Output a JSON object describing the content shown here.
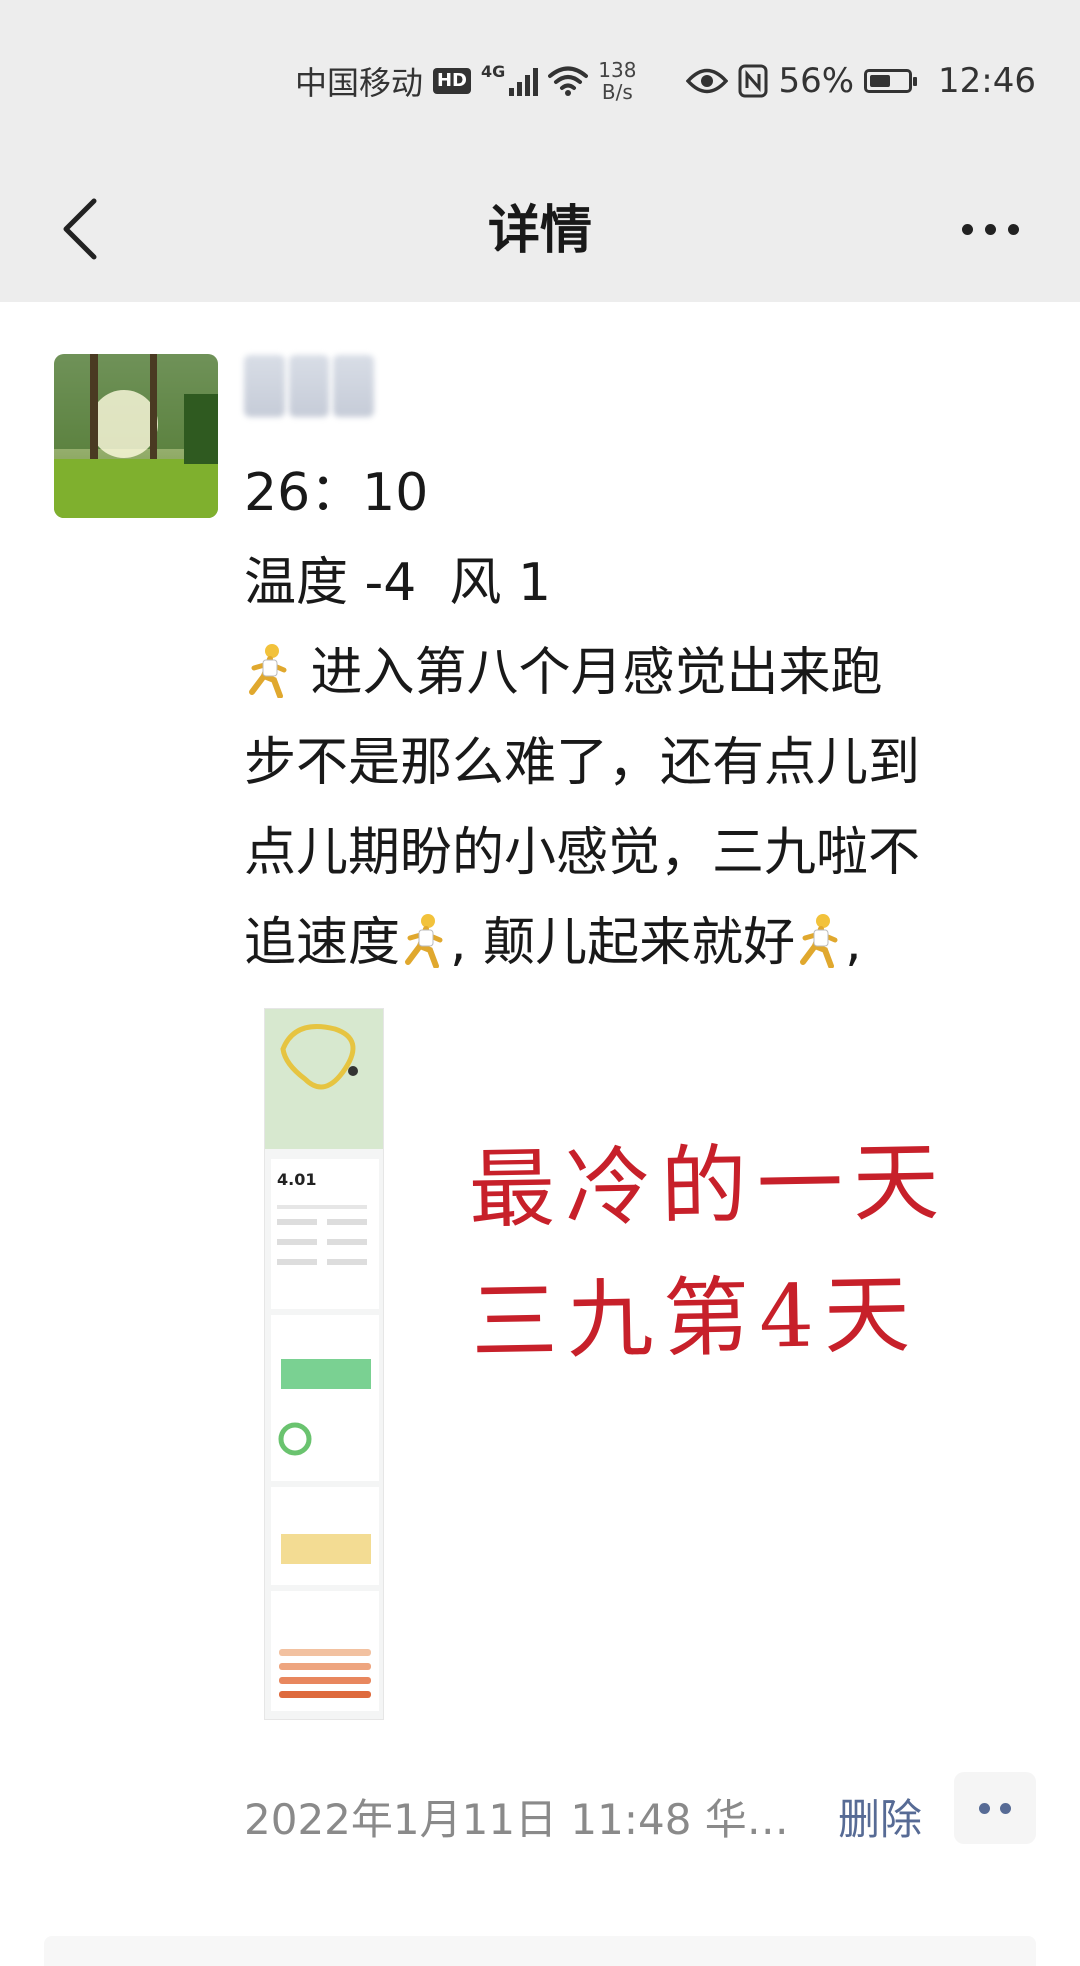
{
  "status_bar": {
    "carrier": "中国移动",
    "hd": "HD",
    "network": "4G",
    "speed_value": "138",
    "speed_unit": "B/s",
    "battery": "56%",
    "time": "12:46"
  },
  "nav": {
    "title": "详情"
  },
  "post": {
    "lines": [
      "26：10",
      "温度 -4  风 1",
      " 进入第八个月感觉出来跑",
      "步不是那么难了，还有点儿到",
      "点儿期盼的小感觉，三九啦不",
      "追速度",
      ", 颠儿起来就好",
      ","
    ],
    "caption_line1": "最冷的一天",
    "caption_line2": "三九第4天",
    "timestamp": "2022年1月11日 11:48  华…",
    "delete_label": "删除"
  },
  "screenshot_thumb": {
    "distance": "4.01"
  },
  "colors": {
    "nav_bg": "#ededed",
    "link": "#576b95",
    "caption": "#c7202a"
  }
}
